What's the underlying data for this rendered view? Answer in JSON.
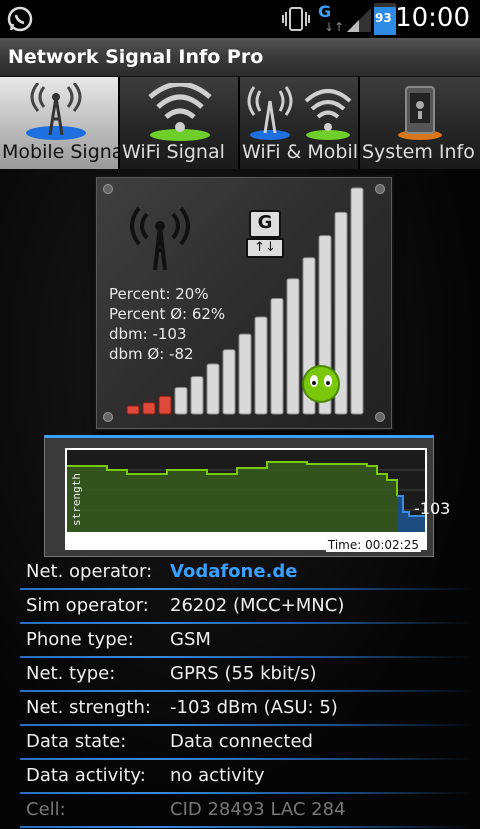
{
  "status_bar": {
    "battery": "93",
    "network_type": "G",
    "time": "10:00",
    "icons": [
      "whatsapp-icon",
      "vibrate-icon",
      "data-activity-icon",
      "battery-icon"
    ]
  },
  "app": {
    "title": "Network Signal Info Pro"
  },
  "tabs": [
    {
      "label": "Mobile Signal",
      "icon": "cell-tower-icon",
      "active": true
    },
    {
      "label": "WiFi Signal",
      "icon": "wifi-icon",
      "active": false
    },
    {
      "label": "WiFi & Mobile",
      "icon": "wifi-mobile-icon",
      "active": false
    },
    {
      "label": "System Info",
      "icon": "phone-info-icon",
      "active": false
    }
  ],
  "signal": {
    "network_badge": "G",
    "stats": [
      "Percent: 20%",
      "Percent Ø: 62%",
      "dbm: -103",
      "dbm Ø: -82"
    ],
    "percent": 20
  },
  "graph": {
    "y_label": "strength",
    "time_label": "Time: 00:02:25",
    "last_value": "-103"
  },
  "info_rows": [
    {
      "key": "Net. operator:",
      "value": "Vodafone.de"
    },
    {
      "key": "Sim operator:",
      "value": "26202 (MCC+MNC)"
    },
    {
      "key": "Phone type:",
      "value": "GSM"
    },
    {
      "key": "Net. type:",
      "value": "GPRS (55 kbit/s)"
    },
    {
      "key": "Net. strength:",
      "value": "-103 dBm (ASU: 5)"
    },
    {
      "key": "Data state:",
      "value": "Data connected"
    },
    {
      "key": "Data activity:",
      "value": "no activity"
    },
    {
      "key": "Cell:",
      "value": "CID 28493 LAC 284"
    }
  ]
}
